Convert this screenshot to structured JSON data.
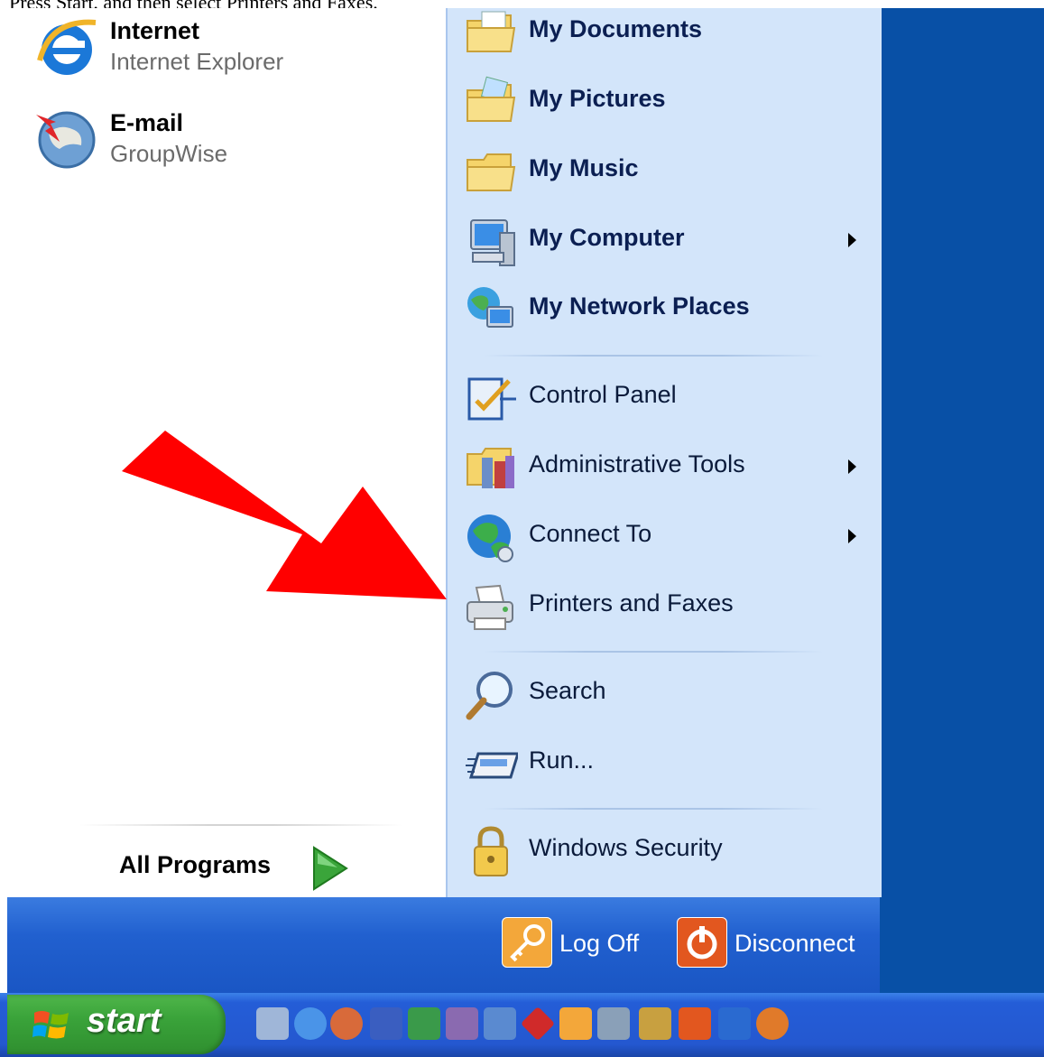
{
  "caption": "Press Start, and then select Printers and Faxes.",
  "pinned": [
    {
      "title": "Internet",
      "subtitle": "Internet Explorer",
      "icon": "internet-explorer-icon"
    },
    {
      "title": "E-mail",
      "subtitle": "GroupWise",
      "icon": "groupwise-icon"
    }
  ],
  "all_programs_label": "All Programs",
  "places": [
    {
      "label": "My Documents",
      "icon": "my-documents-icon",
      "bold": true,
      "arrow": false
    },
    {
      "label": "My Pictures",
      "icon": "my-pictures-icon",
      "bold": true,
      "arrow": false
    },
    {
      "label": "My Music",
      "icon": "my-music-icon",
      "bold": true,
      "arrow": false
    },
    {
      "label": "My Computer",
      "icon": "my-computer-icon",
      "bold": true,
      "arrow": true
    },
    {
      "label": "My Network Places",
      "icon": "network-places-icon",
      "bold": true,
      "arrow": false
    },
    {
      "label": "Control Panel",
      "icon": "control-panel-icon",
      "bold": false,
      "arrow": false
    },
    {
      "label": "Administrative Tools",
      "icon": "admin-tools-icon",
      "bold": false,
      "arrow": true
    },
    {
      "label": "Connect To",
      "icon": "connect-to-icon",
      "bold": false,
      "arrow": true
    },
    {
      "label": "Printers and Faxes",
      "icon": "printer-icon",
      "bold": false,
      "arrow": false
    },
    {
      "label": "Search",
      "icon": "search-icon",
      "bold": false,
      "arrow": false
    },
    {
      "label": "Run...",
      "icon": "run-icon",
      "bold": false,
      "arrow": false
    },
    {
      "label": "Windows Security",
      "icon": "lock-icon",
      "bold": false,
      "arrow": false
    }
  ],
  "bottom": {
    "logoff_label": "Log Off",
    "disconnect_label": "Disconnect"
  },
  "taskbar": {
    "start_label": "start"
  },
  "colors": {
    "accent_blue": "#2160cf",
    "pane_right": "#d3e5fa",
    "arrow_red": "#ff0000",
    "start_green": "#3aa33a"
  }
}
